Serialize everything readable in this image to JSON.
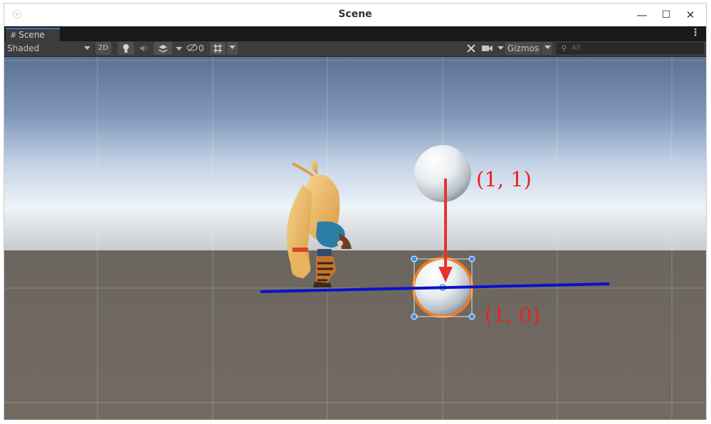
{
  "window": {
    "title": "Scene"
  },
  "window_buttons": {
    "minimize": "—",
    "maximize": "☐",
    "close": "✕"
  },
  "tab": {
    "label": "Scene",
    "icon": "#"
  },
  "menu": {
    "kebab": "⋮"
  },
  "toolbar": {
    "draw_mode": "Shaded",
    "mode_2d": "2D",
    "hidden_count": "0",
    "gizmos": "Gizmos",
    "search_placeholder": "All"
  },
  "scene": {
    "top_label": "(1, 1)",
    "bottom_label": "(1, 0)",
    "colors": {
      "line": "#0a12c8",
      "arrow": "#e8332d",
      "label": "#e8221f",
      "selection": "#f07a1c"
    }
  }
}
